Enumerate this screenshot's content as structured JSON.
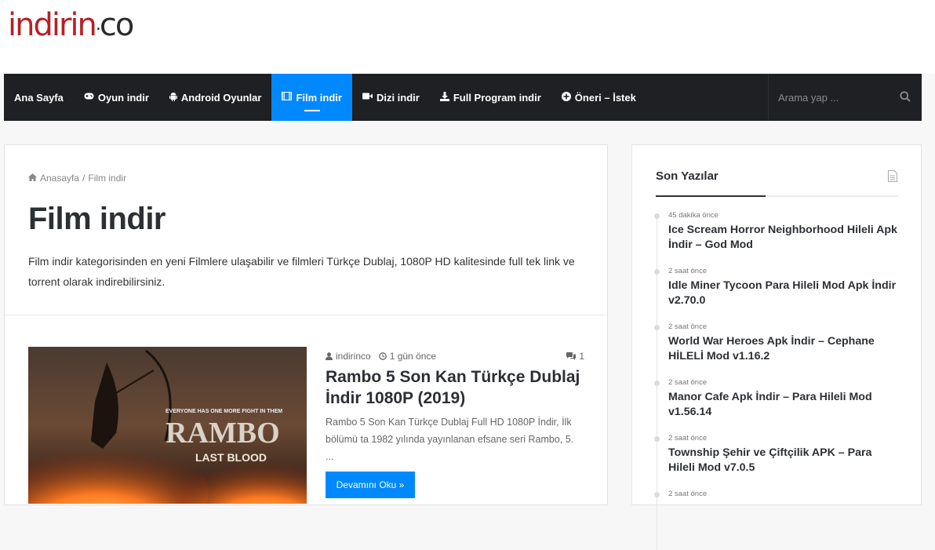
{
  "logo": {
    "part1": "indirin",
    "part2": "co"
  },
  "nav": {
    "items": [
      {
        "label": "Ana Sayfa",
        "icon": ""
      },
      {
        "label": "Oyun indir",
        "icon": "gamepad-icon"
      },
      {
        "label": "Android Oyunlar",
        "icon": "android-icon"
      },
      {
        "label": "Film indir",
        "icon": "film-icon",
        "active": true
      },
      {
        "label": "Dizi indir",
        "icon": "video-camera-icon"
      },
      {
        "label": "Full Program indir",
        "icon": "download-icon"
      },
      {
        "label": "Öneri – İstek",
        "icon": "plus-circle-icon"
      }
    ],
    "search_placeholder": "Arama yap ...",
    "active_color": "#0088ff",
    "bar_color": "#1f2024"
  },
  "breadcrumb": {
    "home": "Anasayfa",
    "separator": "/",
    "current": "Film indir"
  },
  "page": {
    "title": "Film indir",
    "description": "Film indir kategorisinden en yeni Filmlere ulaşabilir ve filmleri Türkçe Dublaj, 1080P HD kalitesinde full tek link ve torrent olarak indirebilirsiniz."
  },
  "post": {
    "author": "indirinco",
    "time": "1 gün önce",
    "comments": "1",
    "title": "Rambo 5 Son Kan Türkçe Dublaj İndir 1080P (2019)",
    "excerpt": "Rambo 5 Son Kan Türkçe Dublaj Full HD 1080P İndir, İlk bölümü ta 1982 yılında yayınlanan efsane seri Rambo, 5. ...",
    "read_more": "Devamını Oku »",
    "thumb": {
      "tagline": "EVERYONE HAS ONE MORE FIGHT IN THEM",
      "title": "RAMBO",
      "subtitle": "LAST BLOOD"
    }
  },
  "sidebar": {
    "title": "Son Yazılar",
    "posts": [
      {
        "time": "45 dakika önce",
        "title": "Ice Scream Horror Neighborhood Hileli Apk İndir – God Mod"
      },
      {
        "time": "2 saat önce",
        "title": "Idle Miner Tycoon Para Hileli Mod Apk İndir v2.70.0"
      },
      {
        "time": "2 saat önce",
        "title": "World War Heroes Apk İndir – Cephane HİLELİ Mod v1.16.2"
      },
      {
        "time": "2 saat önce",
        "title": "Manor Cafe Apk İndir – Para Hileli Mod v1.56.14"
      },
      {
        "time": "2 saat önce",
        "title": "Township Şehir ve Çiftçilik APK – Para Hileli Mod v7.0.5"
      },
      {
        "time": "2 saat önce",
        "title": ""
      }
    ]
  }
}
